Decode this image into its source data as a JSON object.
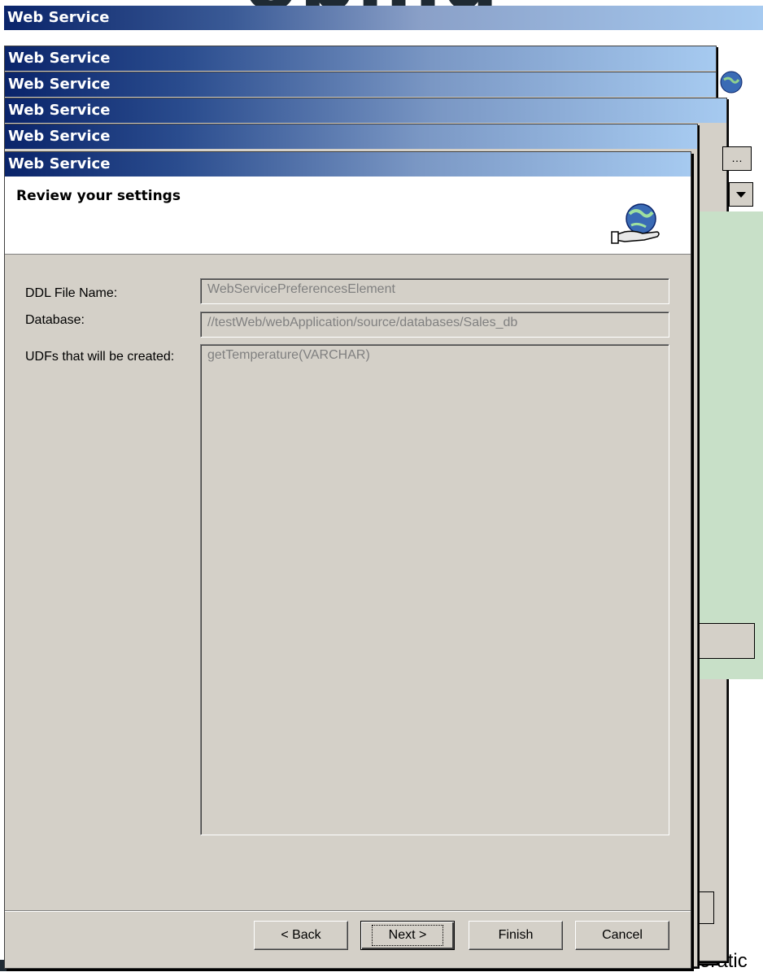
{
  "background": {
    "slide_title_fragment": "oplng",
    "footer_text": "Iporatic"
  },
  "windows": {
    "title": "Web Service"
  },
  "dialog": {
    "title": "Web Service",
    "banner_title": "Review your settings",
    "banner_icon": "globe-hand-icon",
    "fields": {
      "ddl_label": "DDL File Name:",
      "ddl_value": "WebServicePreferencesElement",
      "database_label": "Database:",
      "database_value": "//testWeb/webApplication/source/databases/Sales_db",
      "udfs_label": "UDFs that will be created:",
      "udfs_value": "getTemperature(VARCHAR)"
    },
    "buttons": {
      "back": "< Back",
      "next": "Next >",
      "finish": "Finish",
      "cancel": "Cancel"
    }
  },
  "colors": {
    "titlebar_start": "#0a246a",
    "titlebar_end": "#a6caf0",
    "dialog_face": "#d4d0c8",
    "disabled_text": "#808080"
  }
}
